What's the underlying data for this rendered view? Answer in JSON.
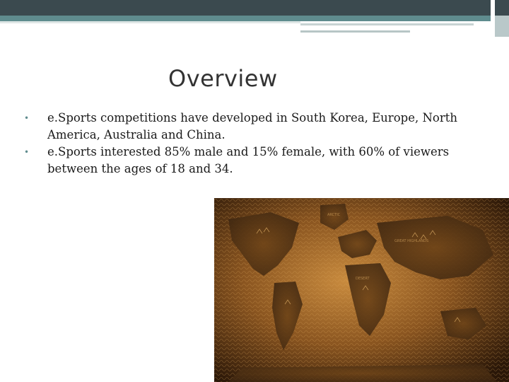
{
  "slide": {
    "title": "Overview",
    "bullets": [
      "e.Sports competitions have developed in South Korea, Europe, North America, Australia and China.",
      "e.Sports interested 85% male and 15% female, with 60% of viewers between the ages of 18 and 34."
    ],
    "bullet_glyph": "•",
    "image": {
      "description_icon": "world-map-image",
      "labels": [
        "GREAT HIGHLANDS",
        "ARCTIC",
        "DESERT"
      ]
    }
  },
  "colors": {
    "header_dark": "#3b4a4f",
    "header_teal": "#5f8c8e",
    "map_dark": "#3a2410",
    "map_light": "#a06b2c"
  }
}
